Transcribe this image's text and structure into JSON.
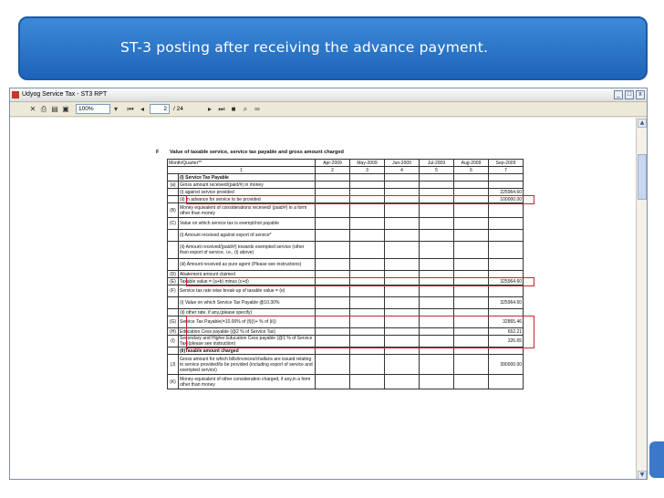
{
  "slide": {
    "title": "ST-3 posting after receiving the advance payment."
  },
  "window": {
    "title": "Udyog Service Tax - ST3 RPT",
    "min": "_",
    "max": "□",
    "close": "x"
  },
  "toolbar": {
    "zoom": "100%",
    "page_current": "2",
    "page_total": "/ 24",
    "icons": [
      "close-icon",
      "print-icon",
      "print-setup-icon",
      "export-icon",
      "zoom-icon",
      "first-page-icon",
      "prev-page-icon",
      "next-page-icon",
      "last-page-icon",
      "stop-icon",
      "search-icon",
      "binoculars-icon"
    ]
  },
  "form": {
    "section_label": "F",
    "section_title": "Value of taxable service, service tax payable and gross amount charged",
    "header": {
      "col_label": "Month/Quarter**",
      "months": [
        "Apr-2009",
        "May-2009",
        "Jun-2009",
        "Jul-2009",
        "Aug-2009",
        "Sep-2009"
      ],
      "numbers": [
        "1",
        "2",
        "3",
        "4",
        "5",
        "6",
        "7"
      ]
    },
    "rows": [
      {
        "code": "",
        "label": "(I) Service Tax Payable",
        "value": ""
      },
      {
        "code": "(a)",
        "label": "Gross amount received/(paid/#) in money",
        "value": ""
      },
      {
        "code": "",
        "label": "(i) against service provided",
        "value": "225964.60"
      },
      {
        "code": "",
        "label": "(ii) in advance for service to be provided",
        "value": "100000.00"
      },
      {
        "code": "(B)",
        "label": "Money equivalent of considerations received/ (paid/#) in a form other than money",
        "value": ""
      },
      {
        "code": "(C)",
        "label": "Value on which service tax is exempt/not payable",
        "value": ""
      },
      {
        "code": "",
        "label": "(i) Amount received against export of service*",
        "value": ""
      },
      {
        "code": "",
        "label": "(ii) Amount received/(paid/#) towards exempted service (other than export of service, i.e., (i) above)",
        "value": ""
      },
      {
        "code": "",
        "label": "(iii) Amount received as pure agent (Please see instructions)",
        "value": ""
      },
      {
        "code": "(D)",
        "label": "Abatement amount claimed",
        "value": ""
      },
      {
        "code": "(E)",
        "label": "Taxable value = (a+b) minus (c+d)",
        "value": "325964.60"
      },
      {
        "code": "(F)",
        "label": "Service tax rate wise break-up of taxable value = (e)",
        "value": ""
      },
      {
        "code": "",
        "label": "(i) Value on which Service Tax Payable @10.30%",
        "value": "325964.60"
      },
      {
        "code": "",
        "label": "(ii) other rate, if any,(please specify)",
        "value": ""
      },
      {
        "code": "(G)",
        "label": "Service Tax Payable(=10.00% of (f)(i)+ % of (ii))",
        "value": "32865.46"
      },
      {
        "code": "(H)",
        "label": "Education Cess payable (@2 % of Service Tax)",
        "value": "652.21"
      },
      {
        "code": "(I)",
        "label": "Secondary and Higher Education Cess payable (@1 % of Service Tax)(please see instruction)",
        "value": "326.65"
      },
      {
        "code": "",
        "label": "(II)Taxable amount charged",
        "value": ""
      },
      {
        "code": "(J)",
        "label": "Gross amount for which bills/invoices/challans are issued relating to service provided/to be provided (including export of service and exempted service)",
        "value": "390000.00"
      },
      {
        "code": "(K)",
        "label": "Money equivalent of other consideration charged, if any,in a form other than money",
        "value": ""
      }
    ]
  }
}
